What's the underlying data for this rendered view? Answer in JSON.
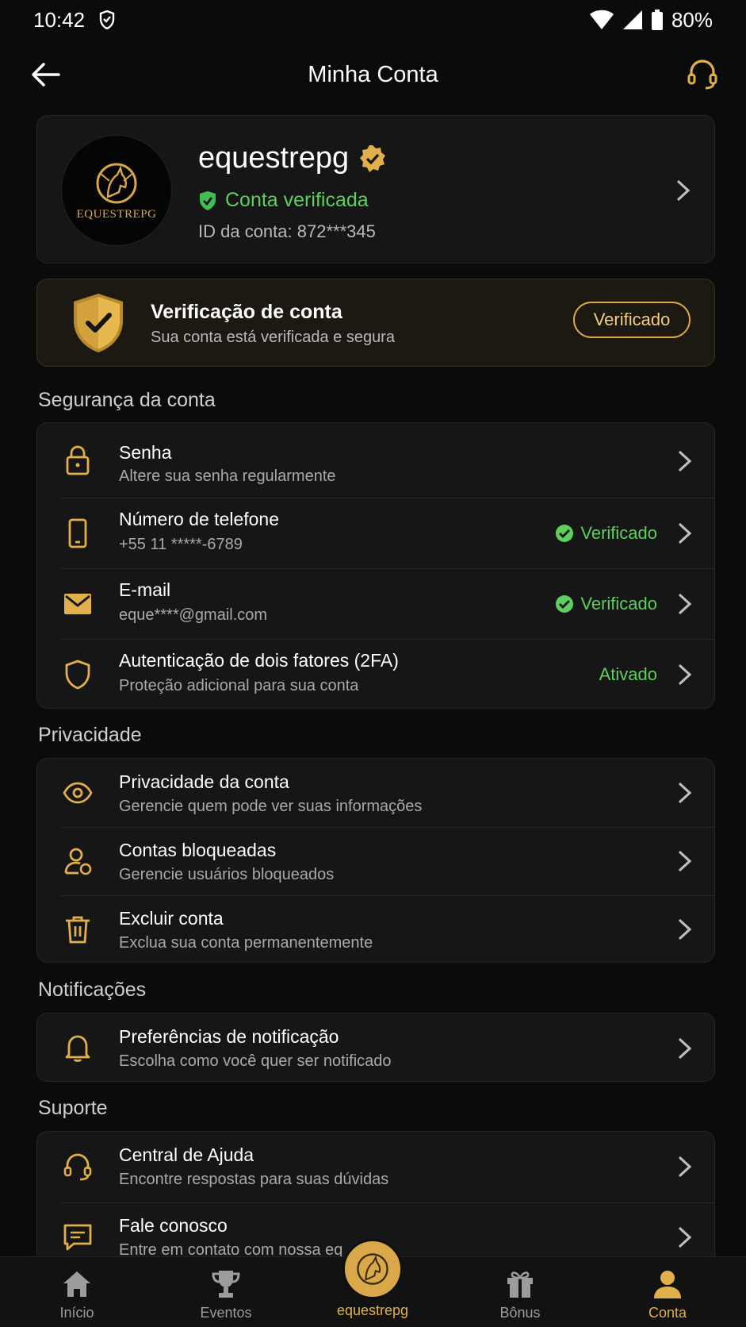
{
  "status": {
    "time": "10:42",
    "battery": "80%"
  },
  "header": {
    "title": "Minha Conta"
  },
  "profile": {
    "username": "equestrepg",
    "verified_label": "Conta verificada",
    "account_id": "ID da conta: 872***345",
    "logo_text": "EQUESTREPG"
  },
  "verification": {
    "title": "Verificação de conta",
    "subtitle": "Sua conta está verificada e segura",
    "button": "Verificado"
  },
  "security": {
    "title": "Segurança da conta",
    "items": [
      {
        "title": "Senha",
        "sub": "Altere sua senha regularmente",
        "badge": ""
      },
      {
        "title": "Número de telefone",
        "sub": "+55 11 *****-6789",
        "badge": "Verificado"
      },
      {
        "title": "E-mail",
        "sub": "eque****@gmail.com",
        "badge": "Verificado"
      },
      {
        "title": "Autenticação de dois fatores (2FA)",
        "sub": "Proteção adicional para sua conta",
        "badge": "Ativado"
      }
    ]
  },
  "privacy": {
    "title": "Privacidade",
    "items": [
      {
        "title": "Privacidade da conta",
        "sub": "Gerencie quem pode ver suas informações"
      },
      {
        "title": "Contas bloqueadas",
        "sub": "Gerencie usuários bloqueados"
      },
      {
        "title": "Excluir conta",
        "sub": "Exclua sua conta permanentemente"
      }
    ]
  },
  "notifications": {
    "title": "Notificações",
    "items": [
      {
        "title": "Preferências de notificação",
        "sub": "Escolha como você quer ser notificado"
      }
    ]
  },
  "support": {
    "title": "Suporte",
    "items": [
      {
        "title": "Central de Ajuda",
        "sub": "Encontre respostas para suas dúvidas"
      },
      {
        "title": "Fale conosco",
        "sub": "Entre em contato com nossa eq"
      }
    ]
  },
  "nav": {
    "home": "Início",
    "events": "Eventos",
    "center": "equestrepg",
    "bonus": "Bônus",
    "account": "Conta"
  },
  "colors": {
    "accent": "#e2b04a",
    "success": "#5dcf5e",
    "background": "#0b0b0b"
  }
}
